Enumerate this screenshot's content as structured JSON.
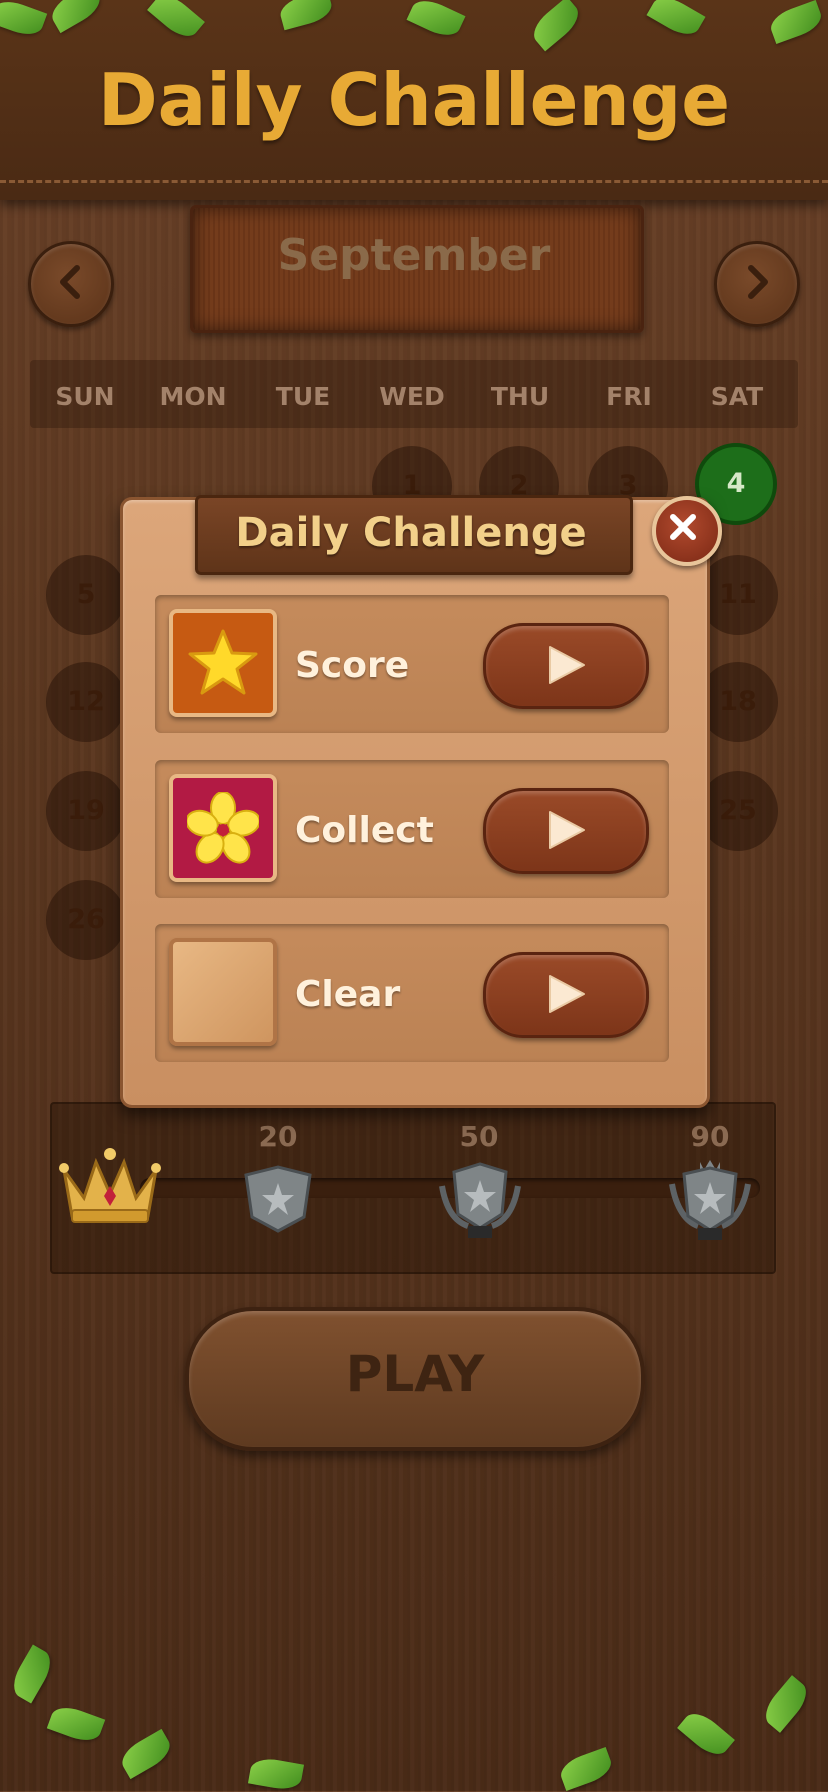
{
  "header": {
    "title": "Daily Challenge"
  },
  "calendar": {
    "month": "September",
    "weekdays": [
      "SUN",
      "MON",
      "TUE",
      "WED",
      "THU",
      "FRI",
      "SAT"
    ],
    "days_visible": [
      "1",
      "2",
      "3",
      "4",
      "5",
      "11",
      "12",
      "18",
      "19",
      "25",
      "26"
    ],
    "current_day": "4",
    "current_day_color": "#1d6e1a"
  },
  "rewards": {
    "milestones": [
      "20",
      "50",
      "90"
    ],
    "progress": 0,
    "start_icon": "crown-icon",
    "badge_icon": "silver-shield-badge-icon"
  },
  "play_button": {
    "label": "PLAY"
  },
  "dialog": {
    "title": "Daily Challenge",
    "close_icon": "close-icon",
    "options": [
      {
        "label": "Score",
        "icon": "star-icon",
        "icon_bg": "#c65a12"
      },
      {
        "label": "Collect",
        "icon": "flower-icon",
        "icon_bg": "#b21a44"
      },
      {
        "label": "Clear",
        "icon": "wood-block-icon",
        "icon_bg": "#d9a470"
      }
    ],
    "play_icon": "play-triangle-icon"
  },
  "colors": {
    "accent": "#e8aa35",
    "wood_dark": "#4a2a14",
    "dialog_bg": "#dca67a"
  }
}
